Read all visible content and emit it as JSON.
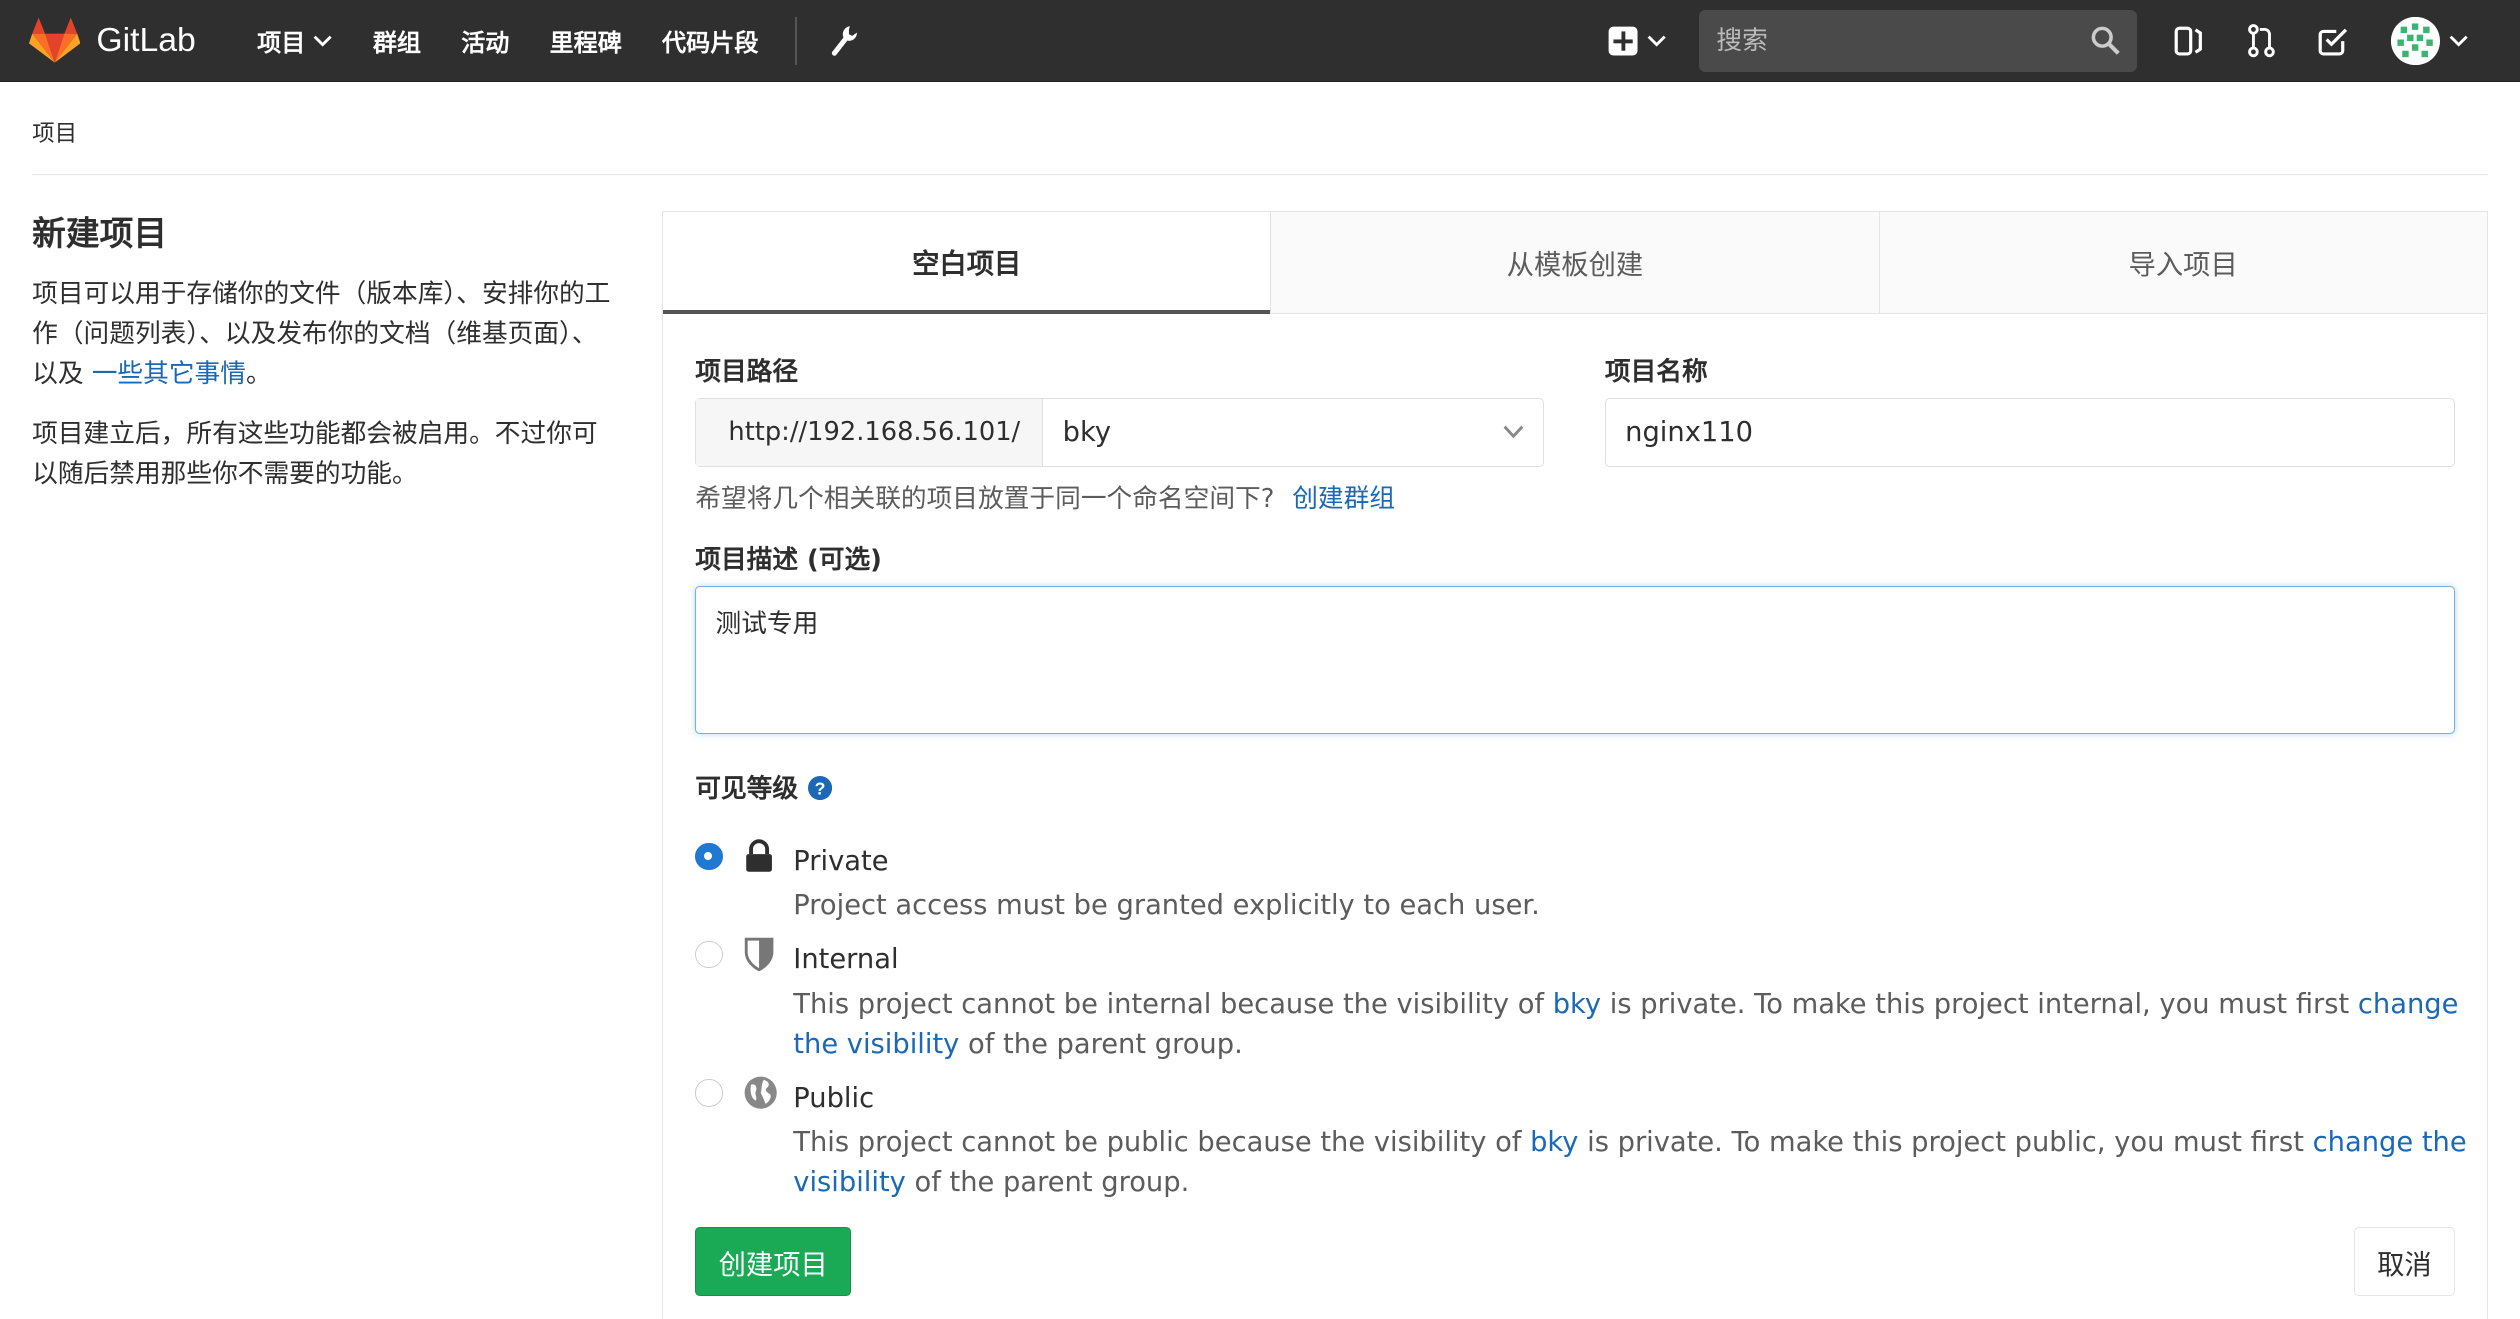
{
  "navbar": {
    "brand": "GitLab",
    "links": [
      "项目",
      "群组",
      "活动",
      "里程碑",
      "代码片段"
    ],
    "search_placeholder": "搜索"
  },
  "breadcrumb": "项目",
  "sidebar": {
    "title": "新建项目",
    "para1_text": "项目可以用于存储你的文件（版本库）、安排你的工作（问题列表）、以及发布你的文档（维基页面）、以及 ",
    "para1_link": "一些其它事情",
    "para1_end": "。",
    "para2": "项目建立后，所有这些功能都会被启用。不过你可以随后禁用那些你不需要的功能。"
  },
  "tabs": [
    "空白项目",
    "从模板创建",
    "导入项目"
  ],
  "form": {
    "path_label": "项目路径",
    "path_prefix": "http://192.168.56.101/",
    "namespace": "bky",
    "name_label": "项目名称",
    "name_value": "nginx110",
    "help_text": "希望将几个相关联的项目放置于同一个命名空间下?",
    "help_link": "创建群组",
    "desc_label": "项目描述 (可选)",
    "desc_value": "测试专用",
    "visibility_label": "可见等级"
  },
  "visibility": [
    {
      "title": "Private",
      "desc": "Project access must be granted explicitly to each user.",
      "checked": true
    },
    {
      "title": "Internal",
      "desc_pre": "This project cannot be internal because the visibility of ",
      "desc_group": "bky",
      "desc_mid": " is private. To make this project internal, you must first ",
      "desc_link": "change the visibility",
      "desc_post": " of the parent group."
    },
    {
      "title": "Public",
      "desc_pre": "This project cannot be public because the visibility of ",
      "desc_group": "bky",
      "desc_mid": " is private. To make this project public, you must first ",
      "desc_link": "change the visibility",
      "desc_post": " of the parent group."
    }
  ],
  "buttons": {
    "create": "创建项目",
    "cancel": "取消"
  },
  "colors": {
    "navbar": "#2f2f2f",
    "link": "#1b69b6",
    "create_button": "#1aaa55",
    "radio_checked": "#1f78d1",
    "brand_orange": "#e24329"
  }
}
